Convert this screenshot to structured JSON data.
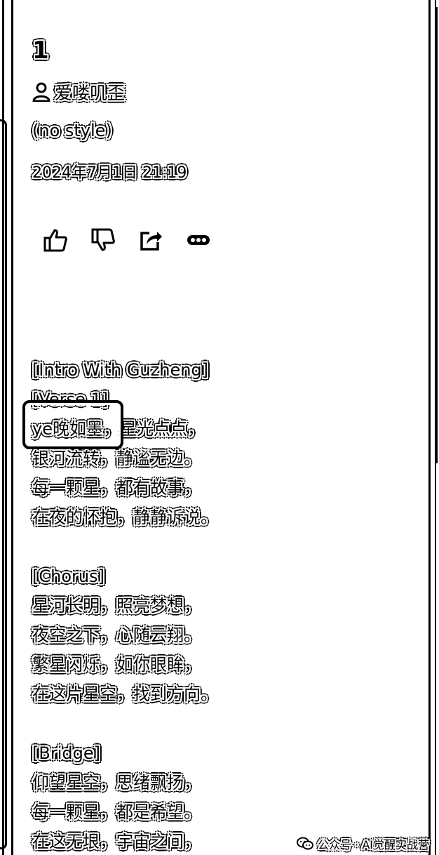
{
  "song": {
    "number": "1",
    "author": "爱喽叽歪",
    "style": "(no style)",
    "date": "2024年7月1日 21:19"
  },
  "actions": [
    {
      "name": "like-button",
      "icon": "thumbs-up-icon"
    },
    {
      "name": "dislike-button",
      "icon": "thumbs-down-icon"
    },
    {
      "name": "share-button",
      "icon": "share-icon"
    },
    {
      "name": "more-button",
      "icon": "more-horizontal-icon"
    }
  ],
  "lyrics": {
    "lines": [
      "[Intro With Guzheng]",
      "[Verse 1]",
      "ye晚如墨，星光点点，",
      "银河流转，静谧无边。",
      "每一颗星，都有故事，",
      "在夜的怀抱，静静诉说。",
      "",
      "[Chorus]",
      "星河长明，照亮梦想，",
      "夜空之下，心随云翔。",
      "繁星闪烁，如你眼眸，",
      "在这片星空，找到方向。",
      "",
      "[Bridge]",
      "仰望星空，思绪飘扬，",
      "每一颗星，都是希望。",
      "在这无垠，宇宙之间，"
    ]
  },
  "watermark": {
    "text": "公众号 · AI觉醒实战营",
    "icon": "wechat-icon"
  }
}
